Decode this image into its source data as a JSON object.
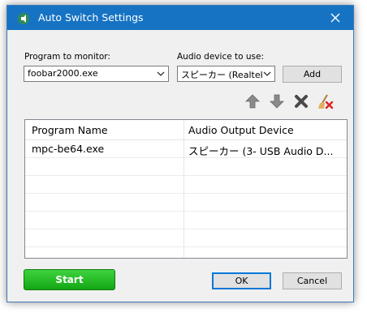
{
  "window": {
    "title": "Auto Switch Settings"
  },
  "program": {
    "label": "Program to monitor:",
    "value": "foobar2000.exe"
  },
  "device": {
    "label": "Audio device to use:",
    "value": "スピーカー (Realtek H"
  },
  "buttons": {
    "add": "Add",
    "start": "Start",
    "ok": "OK",
    "cancel": "Cancel"
  },
  "toolbar": [
    "arrow-up-icon",
    "arrow-down-icon",
    "delete-icon",
    "clear-all-icon"
  ],
  "list": {
    "columns": [
      "Program Name",
      "Audio Output Device"
    ],
    "rows": [
      {
        "program": "mpc-be64.exe",
        "device": "スピーカー (3- USB Audio D..."
      }
    ]
  },
  "colors": {
    "titlebar": "#1673c4",
    "start": "#22b822",
    "accent": "#0078d7"
  }
}
